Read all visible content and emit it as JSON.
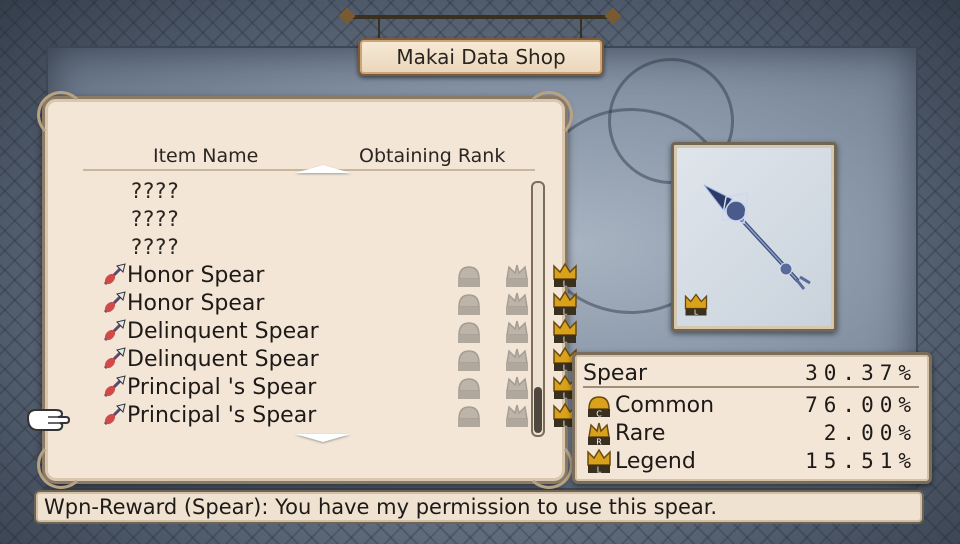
{
  "title": "Makai Data Shop",
  "columns": {
    "item_name": "Item Name",
    "obtaining_rank": "Obtaining Rank"
  },
  "items": [
    {
      "name": "????",
      "known": false
    },
    {
      "name": "????",
      "known": false
    },
    {
      "name": "????",
      "known": false
    },
    {
      "name": "Honor Spear",
      "known": true,
      "icon": "spear-icon",
      "ranks": [
        "common-rank-locked",
        "rare-rank-locked",
        "legend-rank-icon"
      ]
    },
    {
      "name": "Honor Spear",
      "known": true,
      "icon": "spear-icon",
      "ranks": [
        "common-rank-locked",
        "rare-rank-locked",
        "legend-rank-icon"
      ]
    },
    {
      "name": "Delinquent Spear",
      "known": true,
      "icon": "spear-icon",
      "ranks": [
        "common-rank-locked",
        "rare-rank-locked",
        "legend-rank-icon"
      ]
    },
    {
      "name": "Delinquent Spear",
      "known": true,
      "icon": "spear-icon",
      "ranks": [
        "common-rank-locked",
        "rare-rank-locked",
        "legend-rank-icon"
      ]
    },
    {
      "name": "Principal 's Spear",
      "known": true,
      "icon": "spear-icon",
      "ranks": [
        "common-rank-locked",
        "rare-rank-locked",
        "legend-rank-icon"
      ]
    },
    {
      "name": "Principal 's Spear",
      "known": true,
      "icon": "spear-icon",
      "ranks": [
        "common-rank-locked",
        "rare-rank-locked",
        "legend-rank-icon"
      ],
      "selected": true
    }
  ],
  "stats": {
    "category": {
      "label": "Spear",
      "value": "30.37%"
    },
    "rows": [
      {
        "label": "Common",
        "value": "76.00%",
        "icon": "common-rank-icon",
        "letter": "C"
      },
      {
        "label": "Rare",
        "value": "2.00%",
        "icon": "rare-rank-icon",
        "letter": "R"
      },
      {
        "label": "Legend",
        "value": "15.51%",
        "icon": "legend-rank-icon",
        "letter": "L"
      }
    ]
  },
  "message": "Wpn-Reward (Spear): You have my permission to use this spear.",
  "colors": {
    "panel": "#f3e6d6",
    "border": "#7b6d5c",
    "gold": "#d9a21a",
    "locked": "#b9b1a6"
  }
}
